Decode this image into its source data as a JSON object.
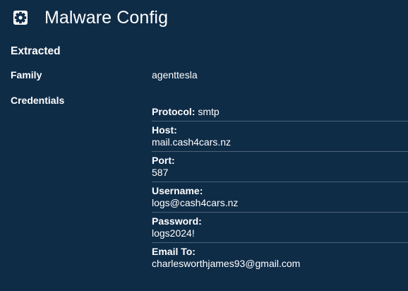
{
  "header": {
    "title": "Malware Config",
    "icon": "gear-icon"
  },
  "section": {
    "title": "Extracted"
  },
  "family": {
    "label": "Family",
    "value": "agenttesla"
  },
  "credentials": {
    "label": "Credentials",
    "protocol": {
      "label": "Protocol:",
      "value": "smtp"
    },
    "host": {
      "label": "Host:",
      "value": "mail.cash4cars.nz"
    },
    "port": {
      "label": "Port:",
      "value": "587"
    },
    "username": {
      "label": "Username:",
      "value": "logs@cash4cars.nz"
    },
    "password": {
      "label": "Password:",
      "value": "logs2024!"
    },
    "email_to": {
      "label": "Email To:",
      "value": "charlesworthjames93@gmail.com"
    }
  },
  "colors": {
    "background": "#0f2c47",
    "text": "#ffffff",
    "divider": "#4b6278"
  }
}
